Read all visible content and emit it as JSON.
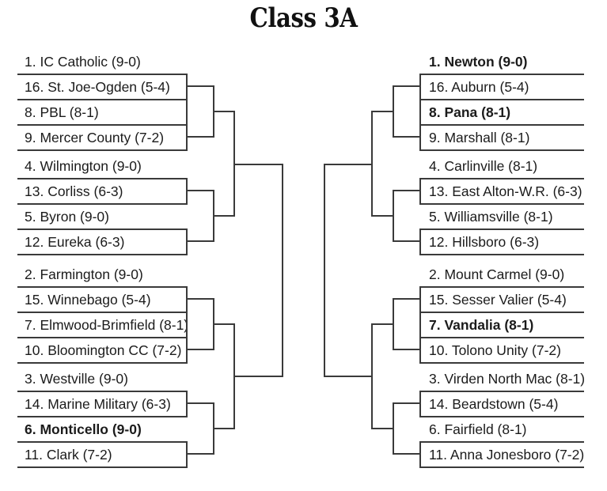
{
  "title": "Class 3A",
  "bracket": {
    "type": "single-elimination",
    "rounds": 4,
    "left_half": {
      "quadrants": [
        {
          "name": "left-upper",
          "teams": [
            {
              "seed": "1",
              "name": "IC Catholic",
              "record": "(9-0)",
              "label": "1. IC Catholic (9-0)",
              "bold": false
            },
            {
              "seed": "16",
              "name": "St. Joe-Ogden",
              "record": "(5-4)",
              "label": "16. St. Joe-Ogden (5-4)",
              "bold": false
            },
            {
              "seed": "8",
              "name": "PBL",
              "record": "(8-1)",
              "label": "8. PBL (8-1)",
              "bold": false
            },
            {
              "seed": "9",
              "name": "Mercer County",
              "record": "(7-2)",
              "label": "9. Mercer County (7-2)",
              "bold": false
            },
            {
              "seed": "4",
              "name": "Wilmington",
              "record": "(9-0)",
              "label": "4. Wilmington (9-0)",
              "bold": false
            },
            {
              "seed": "13",
              "name": "Corliss",
              "record": "(6-3)",
              "label": "13. Corliss (6-3)",
              "bold": false
            },
            {
              "seed": "5",
              "name": "Byron",
              "record": "(9-0)",
              "label": "5. Byron (9-0)",
              "bold": false
            },
            {
              "seed": "12",
              "name": "Eureka",
              "record": "(6-3)",
              "label": "12. Eureka (6-3)",
              "bold": false
            }
          ]
        },
        {
          "name": "left-lower",
          "teams": [
            {
              "seed": "2",
              "name": "Farmington",
              "record": "(9-0)",
              "label": "2. Farmington (9-0)",
              "bold": false
            },
            {
              "seed": "15",
              "name": "Winnebago",
              "record": "(5-4)",
              "label": "15. Winnebago (5-4)",
              "bold": false
            },
            {
              "seed": "7",
              "name": "Elmwood-Brimfield",
              "record": "(8-1)",
              "label": "7. Elmwood-Brimfield (8-1)",
              "bold": false
            },
            {
              "seed": "10",
              "name": "Bloomington CC",
              "record": "(7-2)",
              "label": "10. Bloomington CC (7-2)",
              "bold": false
            },
            {
              "seed": "3",
              "name": "Westville",
              "record": "(9-0)",
              "label": "3. Westville (9-0)",
              "bold": false
            },
            {
              "seed": "14",
              "name": "Marine Military",
              "record": "(6-3)",
              "label": "14. Marine Military (6-3)",
              "bold": false
            },
            {
              "seed": "6",
              "name": "Monticello",
              "record": "(9-0)",
              "label": "6. Monticello (9-0)",
              "bold": true
            },
            {
              "seed": "11",
              "name": "Clark",
              "record": "(7-2)",
              "label": "11. Clark (7-2)",
              "bold": false
            }
          ]
        }
      ]
    },
    "right_half": {
      "quadrants": [
        {
          "name": "right-upper",
          "teams": [
            {
              "seed": "1",
              "name": "Newton",
              "record": "(9-0)",
              "label": "1. Newton (9-0)",
              "bold": true
            },
            {
              "seed": "16",
              "name": "Auburn",
              "record": "(5-4)",
              "label": "16. Auburn (5-4)",
              "bold": false
            },
            {
              "seed": "8",
              "name": "Pana",
              "record": "(8-1)",
              "label": "8. Pana (8-1)",
              "bold": true
            },
            {
              "seed": "9",
              "name": "Marshall",
              "record": "(8-1)",
              "label": "9. Marshall (8-1)",
              "bold": false
            },
            {
              "seed": "4",
              "name": "Carlinville",
              "record": "(8-1)",
              "label": "4. Carlinville (8-1)",
              "bold": false
            },
            {
              "seed": "13",
              "name": "East Alton-W.R.",
              "record": "(6-3)",
              "label": "13. East Alton-W.R. (6-3)",
              "bold": false
            },
            {
              "seed": "5",
              "name": "Williamsville",
              "record": "(8-1)",
              "label": "5. Williamsville (8-1)",
              "bold": false
            },
            {
              "seed": "12",
              "name": "Hillsboro",
              "record": "(6-3)",
              "label": "12. Hillsboro (6-3)",
              "bold": false
            }
          ]
        },
        {
          "name": "right-lower",
          "teams": [
            {
              "seed": "2",
              "name": "Mount Carmel",
              "record": "(9-0)",
              "label": "2. Mount Carmel (9-0)",
              "bold": false
            },
            {
              "seed": "15",
              "name": "Sesser Valier",
              "record": "(5-4)",
              "label": "15. Sesser Valier (5-4)",
              "bold": false
            },
            {
              "seed": "7",
              "name": "Vandalia",
              "record": "(8-1)",
              "label": "7. Vandalia (8-1)",
              "bold": true
            },
            {
              "seed": "10",
              "name": "Tolono Unity",
              "record": "(7-2)",
              "label": "10. Tolono Unity (7-2)",
              "bold": false
            },
            {
              "seed": "3",
              "name": "Virden North Mac",
              "record": "(8-1)",
              "label": "3. Virden North Mac (8-1)",
              "bold": false
            },
            {
              "seed": "14",
              "name": "Beardstown",
              "record": "(5-4)",
              "label": "14. Beardstown (5-4)",
              "bold": false
            },
            {
              "seed": "6",
              "name": "Fairfield",
              "record": "(8-1)",
              "label": "6. Fairfield (8-1)",
              "bold": false
            },
            {
              "seed": "11",
              "name": "Anna Jonesboro",
              "record": "(7-2)",
              "label": "11. Anna Jonesboro (7-2)",
              "bold": false
            }
          ]
        }
      ]
    }
  },
  "colors": {
    "line": "#3a3a3a",
    "text": "#1b1b1b",
    "background": "#ffffff"
  }
}
